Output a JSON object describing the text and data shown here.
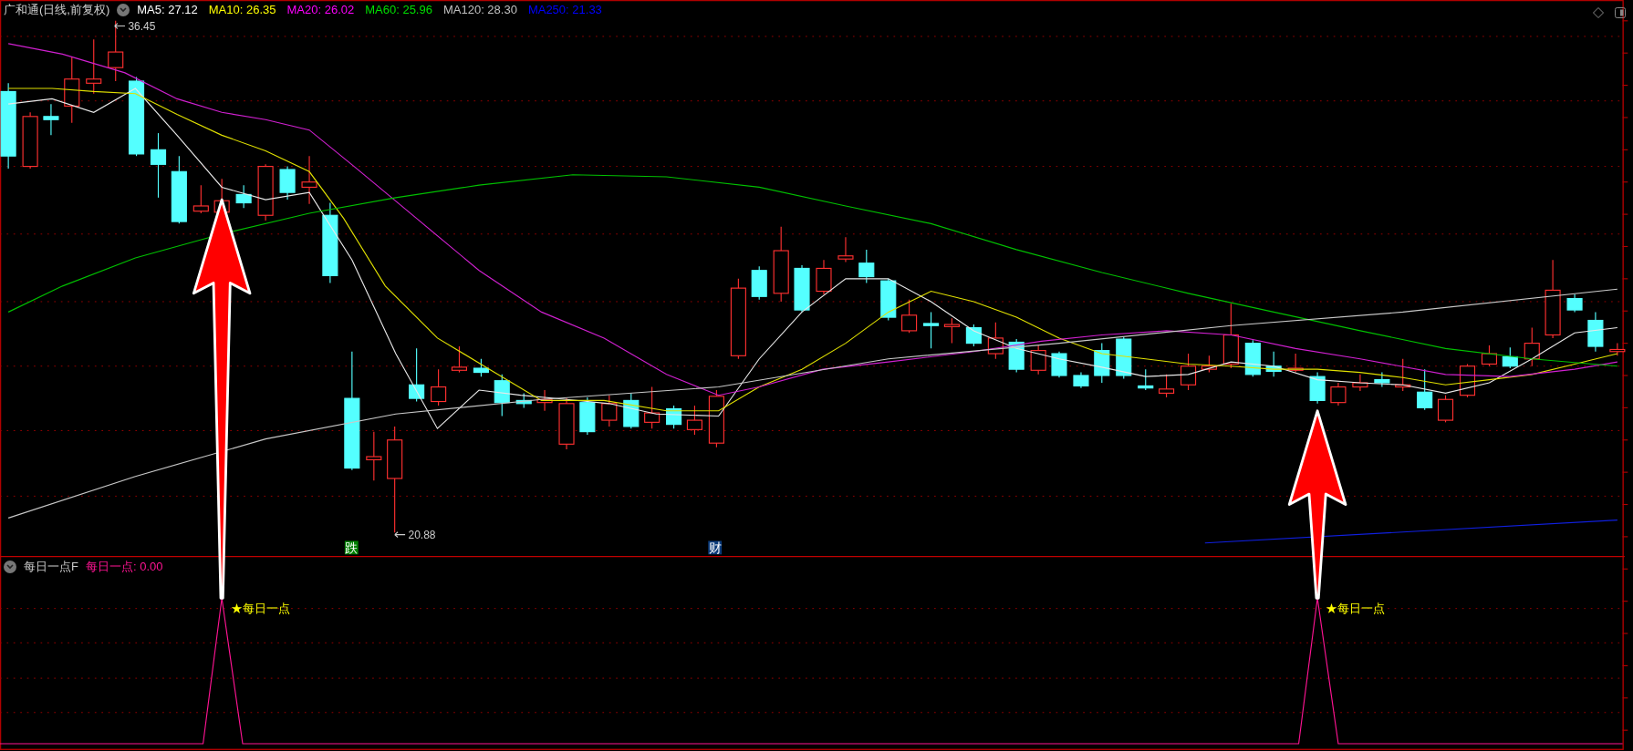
{
  "chart_header": {
    "title": "广和通(日线,前复权)",
    "indicators": [
      {
        "label": "MA5: 27.12",
        "color": "#ffffff"
      },
      {
        "label": "MA10: 26.35",
        "color": "#ffff00"
      },
      {
        "label": "MA20: 26.02",
        "color": "#ff00ff"
      },
      {
        "label": "MA60: 25.96",
        "color": "#00e000"
      },
      {
        "label": "MA120: 28.30",
        "color": "#c0c0c0"
      },
      {
        "label": "MA250: 21.33",
        "color": "#0000ff"
      }
    ]
  },
  "price_labels": [
    {
      "text": "36.45"
    },
    {
      "text": "20.88"
    }
  ],
  "event_badges": [
    {
      "text": "跌",
      "color": "#008000"
    },
    {
      "text": "财",
      "color": "#0a3a7a"
    }
  ],
  "sub_panel": {
    "title": "每日一点F",
    "reading": "每日一点: 0.00",
    "signals": [
      "★每日一点",
      "★每日一点"
    ]
  }
}
